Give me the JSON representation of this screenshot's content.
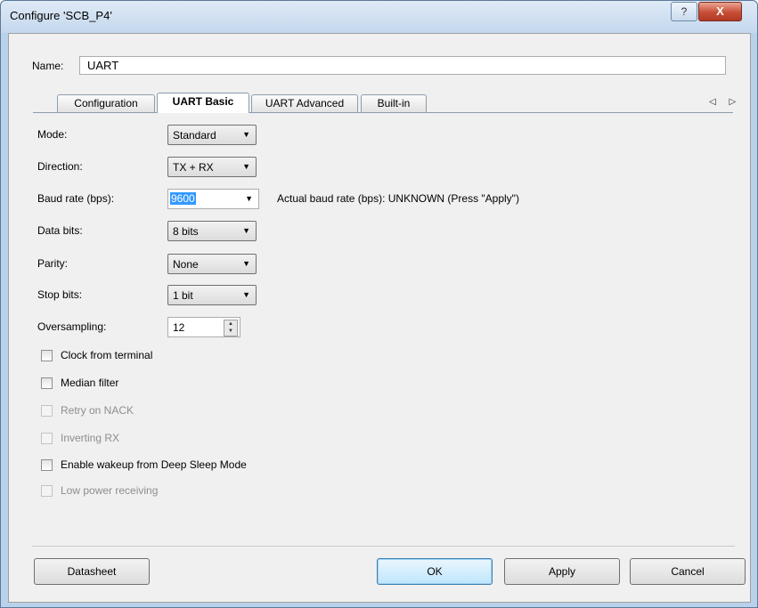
{
  "window": {
    "title": "Configure 'SCB_P4'",
    "help_glyph": "?",
    "close_glyph": "X"
  },
  "name": {
    "label": "Name:",
    "value": "UART"
  },
  "tabs": [
    {
      "label": "Configuration"
    },
    {
      "label": "UART Basic",
      "active": true
    },
    {
      "label": "UART Advanced"
    },
    {
      "label": "Built-in"
    }
  ],
  "tab_scroll": "◁ ▷",
  "fields": {
    "mode": {
      "label": "Mode:",
      "value": "Standard"
    },
    "direction": {
      "label": "Direction:",
      "value": "TX + RX"
    },
    "baud": {
      "label": "Baud rate (bps):",
      "value": "9600",
      "actual": "Actual baud rate (bps): UNKNOWN (Press \"Apply\")"
    },
    "data_bits": {
      "label": "Data bits:",
      "value": "8 bits"
    },
    "parity": {
      "label": "Parity:",
      "value": "None"
    },
    "stop_bits": {
      "label": "Stop bits:",
      "value": "1 bit"
    },
    "oversampling": {
      "label": "Oversampling:",
      "value": "12"
    }
  },
  "checkboxes": [
    {
      "label": "Clock from terminal",
      "checked": false,
      "enabled": true
    },
    {
      "label": "Median filter",
      "checked": false,
      "enabled": true
    },
    {
      "label": "Retry on NACK",
      "checked": false,
      "enabled": false
    },
    {
      "label": "Inverting RX",
      "checked": false,
      "enabled": false
    },
    {
      "label": "Enable wakeup from Deep Sleep Mode",
      "checked": false,
      "enabled": true
    },
    {
      "label": "Low power receiving",
      "checked": false,
      "enabled": false
    }
  ],
  "buttons": {
    "datasheet": "Datasheet",
    "ok": "OK",
    "apply": "Apply",
    "cancel": "Cancel"
  },
  "colors": {
    "selection": "#3399ff",
    "frame": "#b9d1ea",
    "dialog_bg": "#f0f0f0",
    "close_red": "#c74d36"
  },
  "icons": {
    "dropdown": "▼",
    "spin": "▲▼"
  }
}
